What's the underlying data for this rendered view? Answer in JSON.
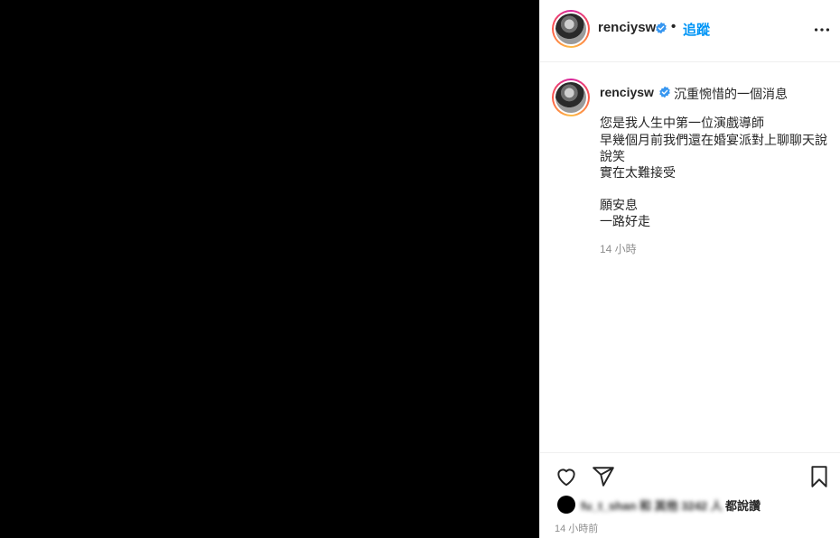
{
  "post": {
    "username": "renciysw",
    "verified": true,
    "separator": "•",
    "follow_label": "追蹤",
    "more_icon": "more-horizontal-icon",
    "media_background": "#000000"
  },
  "caption": {
    "username": "renciysw",
    "lines": [
      "沉重惋惜的一個消息",
      "您是我人生中第一位演戲導師",
      "早幾個月前我們還在婚宴派對上聊聊天說",
      "說笑",
      "實在太難接受",
      "",
      "願安息",
      "一路好走"
    ],
    "time": "14 小時"
  },
  "actions": {
    "like_icon": "heart-icon",
    "share_icon": "send-icon",
    "save_icon": "bookmark-icon"
  },
  "likes": {
    "blurred_text": "fu_t_shan 和 其他 3242 人",
    "label": "都說讚"
  },
  "timestamp": "14 小時前",
  "colors": {
    "link_blue": "#0095f6",
    "verified_blue": "#3897f0",
    "text": "#262626",
    "muted": "#8e8e8e"
  }
}
